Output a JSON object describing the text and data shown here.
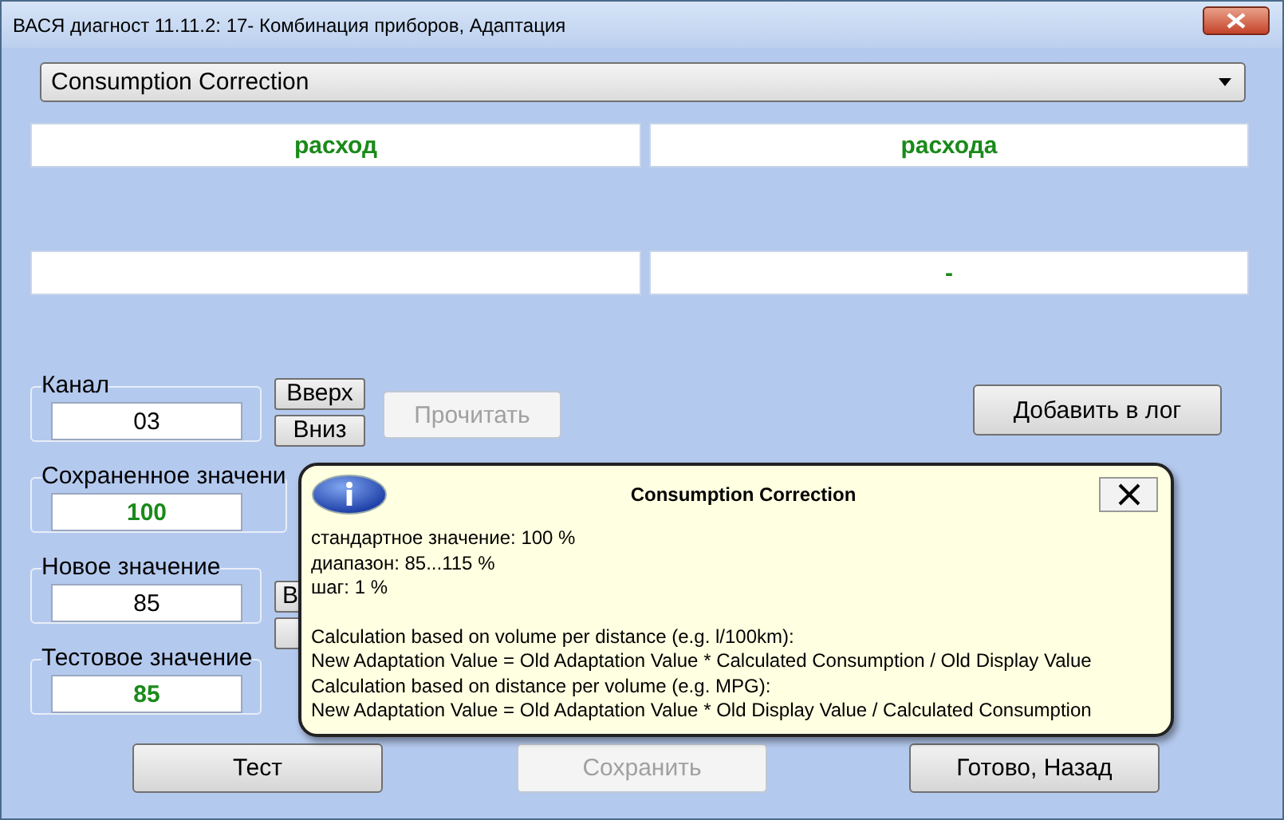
{
  "window": {
    "title": "ВАСЯ диагност 11.11.2: 17- Комбинация приборов, Адаптация"
  },
  "dropdown": {
    "value": "Consumption Correction"
  },
  "upper_fields": [
    "расход",
    "расхода"
  ],
  "lower_fields": {
    "right": "-"
  },
  "channel": {
    "label": "Канал",
    "value": "03",
    "up_button": "Вверх",
    "down_button": "Вниз"
  },
  "read_button": {
    "label": "Прочитать",
    "disabled": true
  },
  "log_button": {
    "label": "Добавить в лог",
    "disabled": false
  },
  "saved_value": {
    "label": "Сохраненное значени",
    "value": "100"
  },
  "new_value": {
    "label": "Новое значение",
    "value": "85",
    "side_button": "В"
  },
  "test_value": {
    "label": "Тестовое значение",
    "value": "85"
  },
  "bottom_buttons": [
    {
      "label": "Тест",
      "disabled": false
    },
    {
      "label": "Сохранить",
      "disabled": true
    },
    {
      "label": "Готово, Назад",
      "disabled": false
    }
  ],
  "tooltip": {
    "title": "Consumption Correction",
    "params": [
      "стандартное значение: 100 %",
      "диапазон: 85...115 %",
      "шаг: 1 %"
    ],
    "formulas": [
      "Calculation based on volume per distance (e.g. l/100km):",
      "New Adaptation Value = Old Adaptation Value * Calculated Consumption / Old Display Value",
      "Calculation based on distance per volume (e.g. MPG):",
      "New Adaptation Value = Old Adaptation Value * Old Display Value / Calculated Consumption"
    ]
  }
}
